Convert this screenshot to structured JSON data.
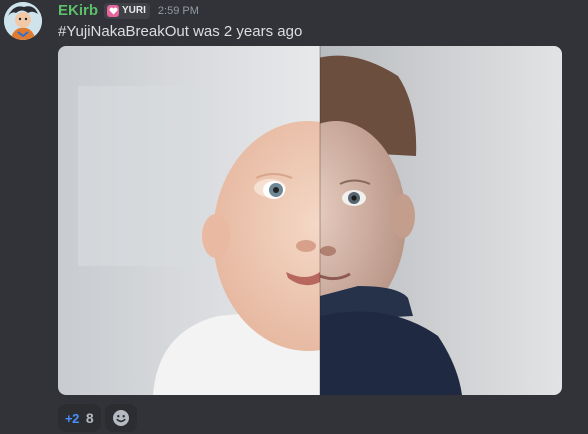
{
  "message": {
    "author": "EKirb",
    "author_color": "#5cbf6a",
    "role_tag": {
      "icon": "heart-icon",
      "icon_color": "#e4669d",
      "label": "YURI"
    },
    "timestamp": "2:59 PM",
    "text": "#YujiNakaBreakOut was 2 years ago",
    "attachment": {
      "kind": "image",
      "alt": "half baby face, half toddler face"
    },
    "reactions": [
      {
        "emoji": "+2",
        "count": "8",
        "emoji_color": "#4a8ef7"
      }
    ],
    "add_reaction_icon": "smiley-plus-icon"
  },
  "theme": {
    "background": "#313338",
    "reaction_bg": "#2b2d31",
    "muted_text": "#949ba4"
  }
}
